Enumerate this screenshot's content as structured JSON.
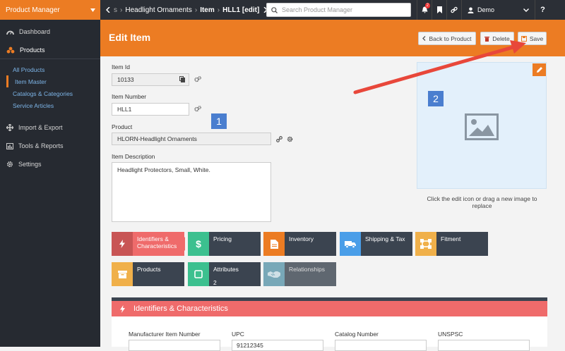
{
  "app": {
    "brand": "Product Manager"
  },
  "breadcrumb": {
    "ellipsis": "s",
    "item1": "Headlight Ornaments",
    "item2": "Item",
    "item3": "HLL1 [edit]"
  },
  "search": {
    "placeholder": "Search Product Manager"
  },
  "topbar": {
    "notification_count": "2",
    "user": "Demo",
    "help": "?"
  },
  "sidebar": {
    "nav": [
      {
        "label": "Dashboard",
        "icon": "dashboard-icon"
      },
      {
        "label": "Products",
        "icon": "products-icon"
      },
      {
        "label": "Import & Export",
        "icon": "move-icon"
      },
      {
        "label": "Tools & Reports",
        "icon": "report-icon"
      },
      {
        "label": "Settings",
        "icon": "gear-icon"
      }
    ],
    "sub": [
      "All Products",
      "Item Master",
      "Catalogs & Categories",
      "Service Articles"
    ]
  },
  "header": {
    "title": "Edit Item",
    "back_label": "Back to Product",
    "delete_label": "Delete",
    "save_label": "Save"
  },
  "form": {
    "item_id_label": "Item Id",
    "item_id_value": "10133",
    "item_number_label": "Item Number",
    "item_number_value": "HLL1",
    "product_label": "Product",
    "product_value": "HLORN-Headlight Ornaments",
    "description_label": "Item Description",
    "description_value": "Headlight Protectors, Small, White."
  },
  "image": {
    "caption": "Click the edit icon or drag a new image to replace"
  },
  "callouts": {
    "one": "1",
    "two": "2"
  },
  "tiles": [
    {
      "label": "Identifiers & Characteristics",
      "line1": "Identifiers &",
      "line2": "Characteristics",
      "color": "#ef6b6b",
      "icon": "bolt-icon"
    },
    {
      "label": "Pricing",
      "color": "#3cc08f",
      "icon": "dollar-icon"
    },
    {
      "label": "Inventory",
      "color": "#ec7c23",
      "icon": "file-icon"
    },
    {
      "label": "Shipping & Tax",
      "color": "#4a9ee8",
      "icon": "truck-icon"
    },
    {
      "label": "Fitment",
      "color": "#f0b04a",
      "icon": "fitment-icon"
    },
    {
      "label": "Products",
      "color": "#f0b04a",
      "icon": "archive-icon"
    },
    {
      "label": "Attributes",
      "count": "2",
      "color": "#3cc08f",
      "icon": "square-icon"
    },
    {
      "label": "Relationships",
      "color": "#78a8b8",
      "icon": "handshake-icon"
    }
  ],
  "section": {
    "title": "Identifiers & Characteristics",
    "fields": [
      {
        "label": "Manufacturer Item Number",
        "value": ""
      },
      {
        "label": "UPC",
        "value": "91212345"
      },
      {
        "label": "Catalog Number",
        "value": ""
      },
      {
        "label": "UNSPSC",
        "value": ""
      }
    ]
  },
  "colors": {
    "accent": "#ec7c23",
    "topbar": "#2b2f36",
    "sidebar": "#262a31",
    "arrow": "#e8473a"
  }
}
